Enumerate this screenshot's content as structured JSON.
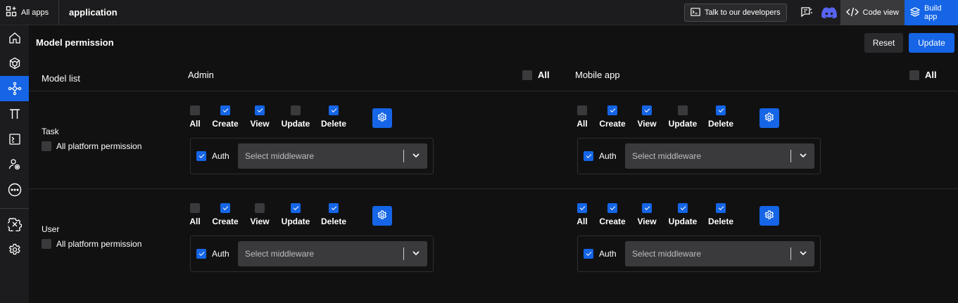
{
  "topbar": {
    "all_apps": "All apps",
    "app_name": "application",
    "talk_label": "Talk to our developers",
    "code_view": "Code view",
    "build_app": "Build app"
  },
  "sidebar_icons": [
    "home-icon",
    "cube-icon",
    "share-nodes-icon",
    "pi-icon",
    "terminal-icon",
    "people-icon",
    "more-icon",
    "gear-tools-icon",
    "settings-icon"
  ],
  "page": {
    "title": "Model permission",
    "reset": "Reset",
    "update": "Update",
    "model_list": "Model list",
    "platforms": [
      {
        "name": "Admin",
        "all_label": "All",
        "all_checked": false
      },
      {
        "name": "Mobile app",
        "all_label": "All",
        "all_checked": false
      }
    ]
  },
  "perm_labels": [
    "All",
    "Create",
    "View",
    "Update",
    "Delete"
  ],
  "auth_label": "Auth",
  "middleware_placeholder": "Select middleware",
  "all_platform_label": "All platform permission",
  "models": [
    {
      "name": "Task",
      "all_platform": false,
      "platforms": [
        {
          "perms": [
            false,
            true,
            true,
            false,
            true
          ],
          "auth": true
        },
        {
          "perms": [
            false,
            true,
            true,
            false,
            true
          ],
          "auth": true
        }
      ]
    },
    {
      "name": "User",
      "all_platform": false,
      "platforms": [
        {
          "perms": [
            false,
            true,
            false,
            true,
            true
          ],
          "auth": true
        },
        {
          "perms": [
            true,
            true,
            true,
            true,
            true
          ],
          "auth": true
        }
      ]
    }
  ],
  "colors": {
    "accent": "#1565e6",
    "background": "#111112",
    "panel": "#1c1c1e"
  }
}
